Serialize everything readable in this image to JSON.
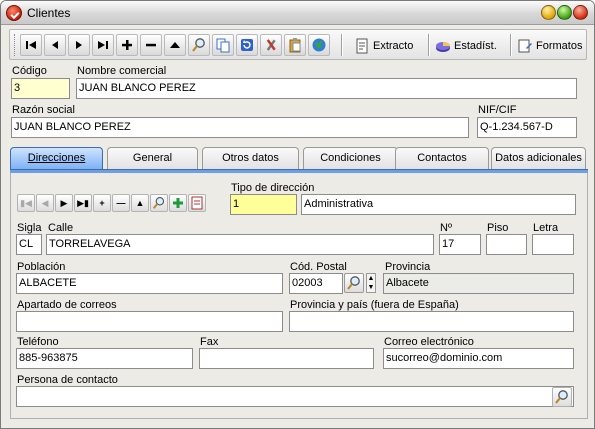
{
  "window": {
    "title": "Clientes"
  },
  "toolbar": {
    "nav_icons": [
      "first-icon",
      "prev-icon",
      "next-icon",
      "last-icon",
      "add-icon",
      "delete-icon",
      "up-icon",
      "search-icon",
      "copy-icon",
      "refresh-icon",
      "tools-icon",
      "paste-icon",
      "globe-icon"
    ],
    "extracto_label": "Extracto",
    "estadist_label": "Estadíst.",
    "formatos_label": "Formatos"
  },
  "header": {
    "codigo_label": "Código",
    "codigo_value": "3",
    "nombre_label": "Nombre comercial",
    "nombre_value": "JUAN BLANCO PEREZ",
    "razon_label": "Razón social",
    "razon_value": "JUAN BLANCO PEREZ",
    "nif_label": "NIF/CIF",
    "nif_value": "Q-1.234.567-D"
  },
  "tabs": [
    {
      "label": "Direcciones",
      "active": true
    },
    {
      "label": "General",
      "active": false
    },
    {
      "label": "Otros datos",
      "active": false
    },
    {
      "label": "Condiciones",
      "active": false
    },
    {
      "label": "Contactos",
      "active": false
    },
    {
      "label": "Datos adicionales",
      "active": false
    }
  ],
  "direcciones": {
    "tipo_label": "Tipo de dirección",
    "tipo_code": "1",
    "tipo_desc": "Administrativa",
    "sigla_label": "Sigla",
    "sigla_value": "CL",
    "calle_label": "Calle",
    "calle_value": "TORRELAVEGA",
    "num_label": "Nº",
    "num_value": "17",
    "piso_label": "Piso",
    "piso_value": "",
    "letra_label": "Letra",
    "letra_value": "",
    "poblacion_label": "Población",
    "poblacion_value": "ALBACETE",
    "cp_label": "Cód. Postal",
    "cp_value": "02003",
    "provincia_label": "Provincia",
    "provincia_value": "Albacete",
    "apartado_label": "Apartado de correos",
    "apartado_value": "",
    "prov_pais_label": "Provincia y país (fuera de España)",
    "prov_pais_value": "",
    "telefono_label": "Teléfono",
    "telefono_value": "885-963875",
    "fax_label": "Fax",
    "fax_value": "",
    "email_label": "Correo electrónico",
    "email_value": "sucorreo@dominio.com",
    "persona_label": "Persona de contacto",
    "persona_value": ""
  },
  "colors": {
    "active_tab": "#7eb2f5",
    "key_field": "#ffffd0",
    "lookup_field": "#ffff99",
    "title_icon": "#c41a0a"
  }
}
